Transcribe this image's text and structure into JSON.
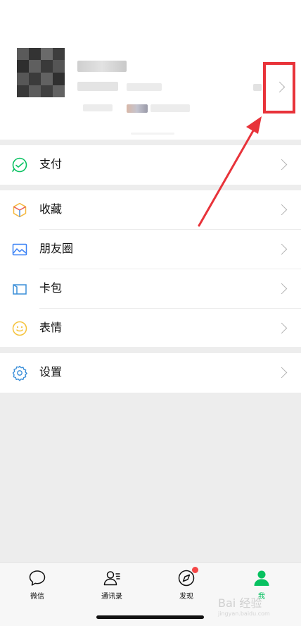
{
  "menu": {
    "pay": {
      "label": "支付",
      "icon": "pay-icon"
    },
    "favorites": {
      "label": "收藏",
      "icon": "favorites-icon"
    },
    "moments": {
      "label": "朋友圈",
      "icon": "moments-icon"
    },
    "cards": {
      "label": "卡包",
      "icon": "card-wallet-icon"
    },
    "stickers": {
      "label": "表情",
      "icon": "sticker-icon"
    },
    "settings": {
      "label": "设置",
      "icon": "settings-icon"
    }
  },
  "tabbar": {
    "chats": {
      "label": "微信",
      "icon": "chat-bubble-icon"
    },
    "contacts": {
      "label": "通讯录",
      "icon": "contacts-icon"
    },
    "discover": {
      "label": "发现",
      "icon": "compass-icon"
    },
    "me": {
      "label": "我",
      "icon": "person-icon"
    }
  },
  "watermark": {
    "text": "Bai 经验",
    "sub": "jingyan.baidu.com"
  },
  "colors": {
    "accent": "#07c160",
    "annotation": "#e8333a",
    "badge": "#f54646"
  }
}
